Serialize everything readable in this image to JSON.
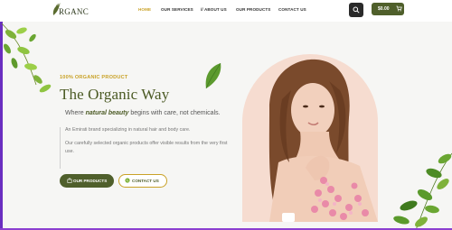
{
  "header": {
    "logo_text": "RGANC",
    "nav": [
      "HOME",
      "OUR SERVICES",
      "// ABOUT US",
      "OUR PRODUCTS",
      "CONTACT US"
    ],
    "active_nav": "HOME",
    "search_icon": "search-icon",
    "cart_label": "$0.00",
    "cart_icon": "cart-icon"
  },
  "hero": {
    "kicker": "100% ORGANIC PRODUCT",
    "title": "The Organic Way",
    "tagline_prefix": "Where ",
    "tagline_emphasis": "natural beauty",
    "tagline_suffix": " begins with care, not chemicals.",
    "description_1": "An Emirati brand specializing in natural hair and body care.",
    "description_2": "Our carefully selected organic products offer visible results from the very first use.",
    "btn_products": "OUR PRODUCTS",
    "btn_contact": "CONTACT US"
  },
  "colors": {
    "brand_green": "#4f5f2b",
    "accent_gold": "#c9a227",
    "photo_bg": "#f6dcd0",
    "edge_purple": "#6a2ec0"
  }
}
